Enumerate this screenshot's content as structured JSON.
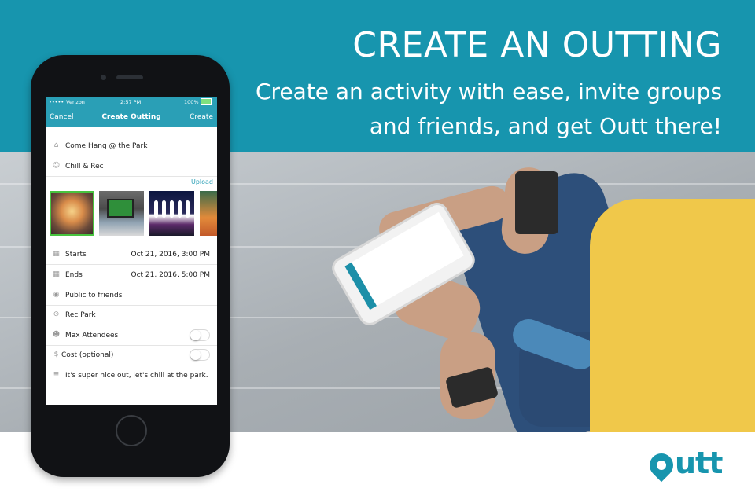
{
  "banner": {
    "headline": "CREATE AN OUTTING",
    "subline": "Create an activity with ease, invite groups and friends, and get Outt there!",
    "color": "#1795ae"
  },
  "status_bar": {
    "carrier": "Verizon",
    "time": "2:57 PM",
    "battery": "100%"
  },
  "nav": {
    "cancel": "Cancel",
    "title": "Create Outting",
    "create": "Create"
  },
  "form": {
    "name": "Come Hang @ the Park",
    "category": "Chill & Rec",
    "upload_label": "Upload",
    "starts_label": "Starts",
    "starts_value": "Oct 21, 2016, 3:00 PM",
    "ends_label": "Ends",
    "ends_value": "Oct 21, 2016, 5:00 PM",
    "visibility": "Public to friends",
    "location": "Rec Park",
    "max_attendees_label": "Max Attendees",
    "cost_label": "Cost (optional)",
    "description": "It's super nice out, let's chill at the park."
  },
  "icons": {
    "name": "tag-icon",
    "category": "smiley-icon",
    "starts": "calendar-icon",
    "ends": "calendar-icon",
    "visibility": "eye-icon",
    "location": "location-pin-icon",
    "max_attendees": "people-icon",
    "cost": "dollar-icon",
    "description": "note-icon"
  },
  "logo": {
    "text": "utt",
    "color": "#1795ae"
  }
}
